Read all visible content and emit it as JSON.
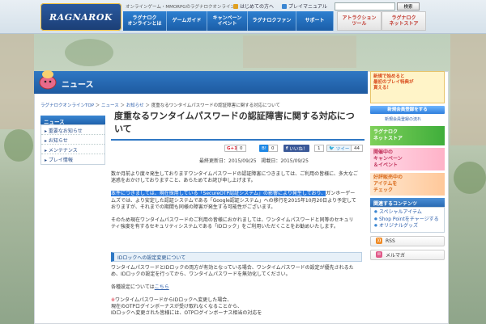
{
  "header": {
    "logo_text": "RAGNAROK",
    "tagline": "オンラインゲーム・MMORPGのラグナロクオンライン",
    "links": [
      "はじめての方へ",
      "プレイマニュアル"
    ],
    "search_placeholder": "",
    "search_button": "検索",
    "nav": [
      "ラグナロク\nオンラインとは",
      "ゲームガイド",
      "キャンペーン\nイベント",
      "ラグナロクファン",
      "サポート"
    ],
    "nav_right": [
      "アトラクション\nツール",
      "ラグナロク\nネットストア"
    ]
  },
  "section_title": "ニュース",
  "breadcrumb": {
    "links": [
      "ラグナロクオンラインTOP",
      "ニュース",
      "お知らせ"
    ],
    "current": "度重なるワンタイムパスワードの認証障害に関する対応について",
    "sep": "＞"
  },
  "sidebar": {
    "header": "ニュース",
    "items": [
      "重要なお知らせ",
      "お知らせ",
      "メンテナンス",
      "プレイ情報"
    ]
  },
  "article": {
    "title": "度重なるワンタイムパスワードの認証障害に関する対応について",
    "share": {
      "gplus": "G+1",
      "gplus_count": "0",
      "hatena_count": "0",
      "like": "いいね！",
      "like_count": "1",
      "tweet": "ツイート",
      "tweet_count": "44"
    },
    "updated_label": "最終更新日：2015/09/25",
    "posted_label": "掲載日：2015/09/25",
    "para1": "数か月前より度々発生しておりますワンタイムパスワードの認証障害につきましては、ご利用の皆様に、多大なご迷惑をおかけしておりますこと、あらためてお詫び申し上げます。",
    "para2_hl": "本件につきましては、現在採用している「SecureOTP認証システム」の影響により発生しており、",
    "para2_rest": "ガンホーゲームズでは、より安定した認証システムである「Google認証システム」への移行を2015年10月20日より予定しておりますが、それまでの期間も同様の障害が発生する可能性がございます。",
    "para3": "そのため現在ワンタイムパスワードのご利用の皆様におかれましては、ワンタイムパスワードと同等のセキュリティ強度を有するセキュリティシステムである「IDロック」をご利用いただくことをお勧めいたします。",
    "section_heading": "IDロックへの設定変更について",
    "para4": "ワンタイムパスワードとIDロックの両方が有効となっている場合、ワンタイムパスワードの設定が優先されるため、IDロックの設定を行ってから、ワンタイムパスワードを無効化してください。",
    "para5": "各種設定については",
    "para5_link": "こちら",
    "note_mark": "※",
    "note1": "ワンタイムパスワードからIDロックへ変更した場合、",
    "note2": "現在のOTPログインボーナスが受け取れなくなることから、",
    "note3": "IDロックへ変更された皆様には、OTPログインボーナス相当の対応を"
  },
  "right": {
    "promo_lines": [
      "新規で始めると",
      "最初のプレイ特典が",
      "貰える！"
    ],
    "promo_button": "新規会員登録をする",
    "promo_note": "新規会員登録の流れ",
    "banner_store": "ラグナロク\nネットストア",
    "banner_campaign": "開催中の\nキャンペーン\n＆イベント",
    "banner_gift": "好評販売中の\nアイテムを\nチェック",
    "related_header": "関連するコンテンツ",
    "related": [
      "スペシャルアイテム",
      "Shop Pointをチャージする",
      "オリジナルグッズ"
    ],
    "rss": "RSS",
    "mail": "メルマガ"
  },
  "colors": {
    "brand_blue": "#2f78c4",
    "highlight": "#2a7adf",
    "accent_red": "#c0362c"
  }
}
